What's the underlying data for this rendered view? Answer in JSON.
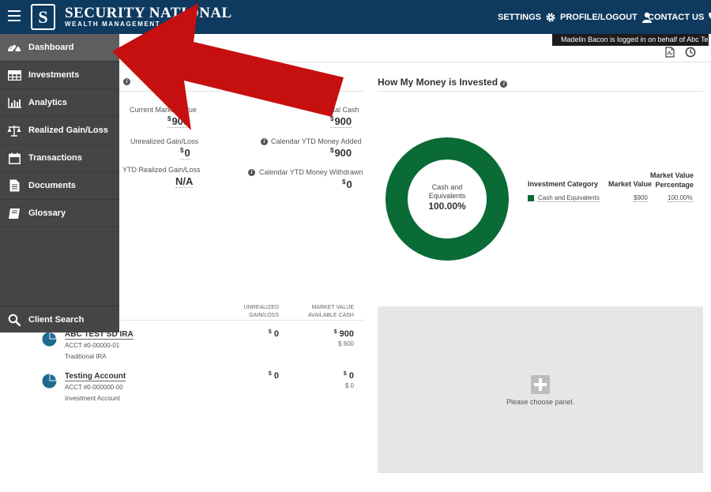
{
  "header": {
    "logo_letter": "S",
    "brand_name": "SECURITY NATIONAL",
    "brand_sub": "WEALTH MANAGEMENT",
    "nav": {
      "settings": "SETTINGS",
      "profile": "PROFILE/LOGOUT",
      "contact": "CONTACT US"
    },
    "tooltip": "Madelin Bacon is logged in on behalf of Abc Test"
  },
  "sidebar": {
    "items": [
      {
        "label": "Dashboard",
        "icon": "gauge-icon",
        "active": true
      },
      {
        "label": "Investments",
        "icon": "table-icon"
      },
      {
        "label": "Analytics",
        "icon": "bar-chart-icon"
      },
      {
        "label": "Realized Gain/Loss",
        "icon": "scale-icon"
      },
      {
        "label": "Transactions",
        "icon": "calendar-icon"
      },
      {
        "label": "Documents",
        "icon": "document-icon"
      },
      {
        "label": "Glossary",
        "icon": "book-icon"
      }
    ],
    "search_label": "Client Search"
  },
  "summary": {
    "current_market_value_label": "Current Market Value",
    "current_market_value": "900",
    "unrealized_label": "Unrealized Gain/Loss",
    "unrealized_value": "0",
    "ytd_realized_label": "YTD Realized Gain/Loss",
    "ytd_realized_value": "N/A",
    "total_cash_label": "Total Cash",
    "total_cash_value": "900",
    "ytd_added_label": "Calendar YTD Money Added",
    "ytd_added_value": "900",
    "ytd_withdrawn_label": "Calendar YTD Money Withdrawn",
    "ytd_withdrawn_value": "0",
    "currency": "$"
  },
  "invested": {
    "title": "How My Money is Invested",
    "donut_label_line1": "Cash and",
    "donut_label_line2": "Equivalents",
    "donut_percent": "100.00%",
    "legend": {
      "col_category": "Investment Category",
      "col_market_value": "Market Value",
      "col_mv_percentage_line1": "Market Value",
      "col_mv_percentage_line2": "Percentage",
      "rows": [
        {
          "category": "Cash and Equivalents",
          "market_value": "$900",
          "percentage": "100.00%"
        }
      ]
    },
    "accent_color": "#0a6b36"
  },
  "accounts": {
    "col_unrealized_line1": "UNREALIZED",
    "col_unrealized_line2": "GAIN/LOSS",
    "col_mv_line1": "MARKET VALUE",
    "col_mv_line2": "AVAILABLE CASH",
    "rows": [
      {
        "name": "ABC TEST SD IRA",
        "acct": "ACCT #0-00000-01",
        "type": "Traditional IRA",
        "unrealized": "0",
        "market_value": "900",
        "available_cash": "$ 900"
      },
      {
        "name": "Testing Account",
        "acct": "ACCT #0-000000-00",
        "type": "Investment Account",
        "unrealized": "0",
        "market_value": "0",
        "available_cash": "$ 0"
      }
    ]
  },
  "choose_panel": {
    "text": "Please choose panel."
  }
}
